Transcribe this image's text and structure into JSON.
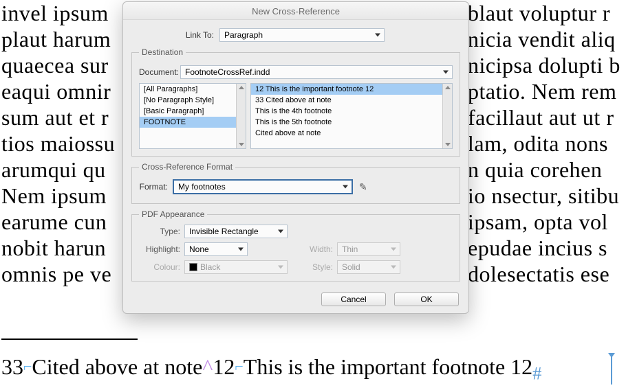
{
  "dialog": {
    "title": "New Cross-Reference",
    "link_to_label": "Link To:",
    "link_to_value": "Paragraph",
    "destination": {
      "legend": "Destination",
      "document_label": "Document:",
      "document_value": "FootnoteCrossRef.indd",
      "styles": [
        "[All Paragraphs]",
        "[No Paragraph Style]",
        "[Basic Paragraph]",
        "FOOTNOTE"
      ],
      "styles_selected": 3,
      "items": [
        "12  This is the important footnote 12",
        "33  Cited above at note",
        "This is the 4th footnote",
        "This is the 5th footnote",
        "Cited above at note"
      ],
      "items_selected": 0
    },
    "format": {
      "legend": "Cross-Reference Format",
      "label": "Format:",
      "value": "My footnotes"
    },
    "pdf": {
      "legend": "PDF Appearance",
      "type_label": "Type:",
      "type_value": "Invisible Rectangle",
      "highlight_label": "Highlight:",
      "highlight_value": "None",
      "colour_label": "Colour:",
      "colour_value": "Black",
      "width_label": "Width:",
      "width_value": "Thin",
      "style_label": "Style:",
      "style_value": "Solid"
    },
    "buttons": {
      "cancel": "Cancel",
      "ok": "OK"
    }
  },
  "document": {
    "lines": [
      "invel ipsum",
      "plaut harum",
      "quaecea sur",
      "eaqui omnir",
      "sum aut et r",
      "tios maiossu",
      "arumqui qu",
      "Nem ipsum",
      "earume cun",
      "nobit harun",
      "omnis pe ve"
    ],
    "lines_r": [
      "blaut voluptur r",
      "nicia vendit aliq",
      "nicipsa dolupti b",
      "ptatio. Nem rem",
      "facillaut aut ut r",
      "lam, odita nons",
      "n quia corehen",
      "io nsectur, sitibu",
      "ipsam, opta vol",
      "epudae incius s",
      "dolesectatis ese"
    ],
    "footnote": "33  Cited above at note 12  This is the important footnote 12"
  }
}
